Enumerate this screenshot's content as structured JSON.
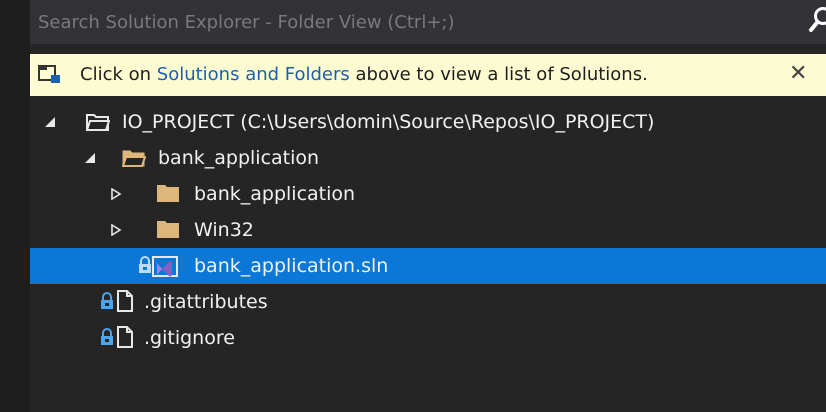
{
  "search": {
    "placeholder": "Search Solution Explorer - Folder View (Ctrl+;)"
  },
  "infobar": {
    "prefix": "Click on ",
    "link": "Solutions and Folders",
    "suffix": " above to view a list of Solutions.",
    "close": "✕"
  },
  "tree": {
    "root": "IO_PROJECT (C:\\Users\\domin\\Source\\Repos\\IO_PROJECT)",
    "folder_bank_application": "bank_application",
    "subfolder_bank_application": "bank_application",
    "subfolder_win32": "Win32",
    "solution_file": "bank_application.sln",
    "gitattributes": ".gitattributes",
    "gitignore": ".gitignore"
  },
  "colors": {
    "background": "#252526",
    "selection": "#0b78d7",
    "folder": "#dcb67a",
    "infobar_bg": "#fdfbd2",
    "link": "#1a5fb4"
  }
}
